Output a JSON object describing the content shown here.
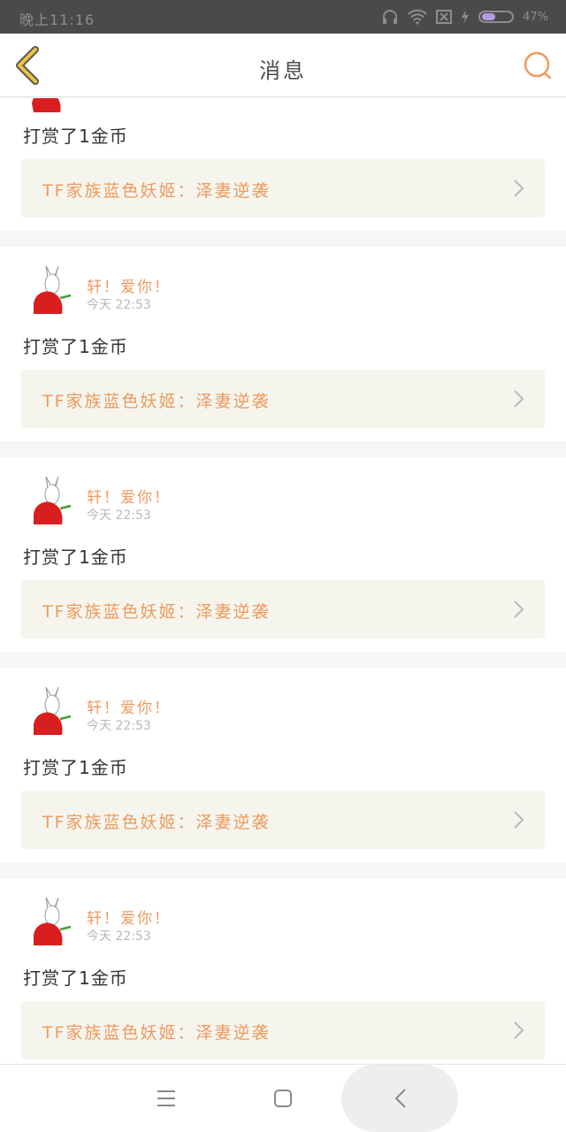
{
  "status_bar": {
    "time": "晚上11:16",
    "battery_percent": 47,
    "battery_label": "47%",
    "icons": [
      "headphones-icon",
      "wifi-icon",
      "sim-off-icon",
      "charging-bolt-icon",
      "battery-icon"
    ]
  },
  "header": {
    "title": "消息",
    "back_icon": "chevron-left-icon",
    "search_icon": "search-icon"
  },
  "messages": [
    {
      "user": "",
      "time": "",
      "action": "打赏了1金币",
      "link_text": "TF家族蓝色妖姬：泽妻逆袭"
    },
    {
      "user": "轩！爱你！",
      "time": "今天 22:53",
      "action": "打赏了1金币",
      "link_text": "TF家族蓝色妖姬：泽妻逆袭"
    },
    {
      "user": "轩！爱你！",
      "time": "今天 22:53",
      "action": "打赏了1金币",
      "link_text": "TF家族蓝色妖姬：泽妻逆袭"
    },
    {
      "user": "轩！爱你！",
      "time": "今天 22:53",
      "action": "打赏了1金币",
      "link_text": "TF家族蓝色妖姬：泽妻逆袭"
    },
    {
      "user": "轩！爱你！",
      "time": "今天 22:53",
      "action": "打赏了1金币",
      "link_text": "TF家族蓝色妖姬：泽妻逆袭"
    }
  ],
  "nav_bar": {
    "icons": [
      "menu-icon",
      "home-square-icon",
      "back-icon"
    ]
  },
  "colors": {
    "accent": "#ee9a5e",
    "back_arrow": "#f0c43a",
    "link_bg": "#f5f5ee",
    "divider_bg": "#f7f5f5"
  }
}
